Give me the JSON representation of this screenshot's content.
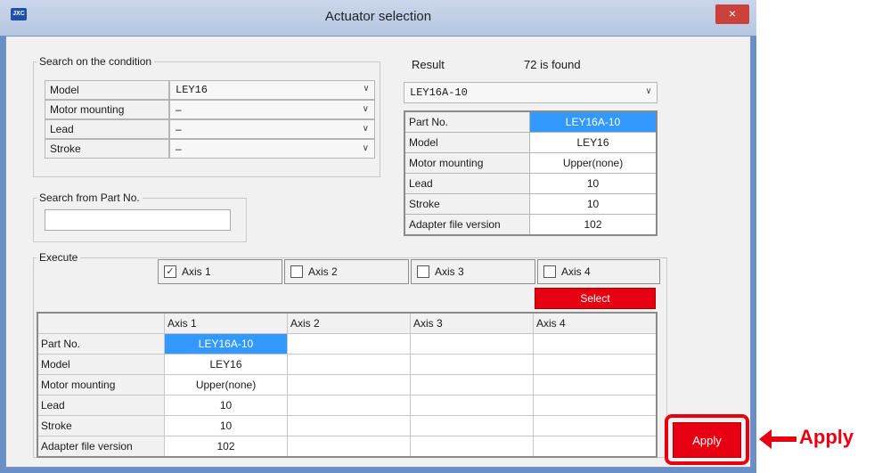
{
  "window": {
    "title": "Actuator selection",
    "app_icon_text": "JXC",
    "close_glyph": "×"
  },
  "search": {
    "group_label": "Search on the condition",
    "fields": [
      {
        "label": "Model",
        "value": "LEY16"
      },
      {
        "label": "Motor mounting",
        "value": "–"
      },
      {
        "label": "Lead",
        "value": "–"
      },
      {
        "label": "Stroke",
        "value": "–"
      }
    ]
  },
  "partno_search": {
    "group_label": "Search from Part No.",
    "value": ""
  },
  "result": {
    "label": "Result",
    "count_text": "72 is found",
    "selected": "LEY16A-10",
    "rows": [
      {
        "label": "Part No.",
        "value": "LEY16A-10"
      },
      {
        "label": "Model",
        "value": "LEY16"
      },
      {
        "label": "Motor mounting",
        "value": "Upper(none)"
      },
      {
        "label": "Lead",
        "value": "10"
      },
      {
        "label": "Stroke",
        "value": "10"
      },
      {
        "label": "Adapter file version",
        "value": "102"
      }
    ]
  },
  "execute": {
    "group_label": "Execute",
    "axes": [
      {
        "label": "Axis 1",
        "checked": true
      },
      {
        "label": "Axis 2",
        "checked": false
      },
      {
        "label": "Axis 3",
        "checked": false
      },
      {
        "label": "Axis 4",
        "checked": false
      }
    ],
    "select_label": "Select",
    "check_glyph": "✓"
  },
  "grid": {
    "headers": [
      "",
      "Axis 1",
      "Axis 2",
      "Axis 3",
      "Axis 4"
    ],
    "rows": [
      {
        "label": "Part No.",
        "cells": [
          "LEY16A-10",
          "",
          "",
          ""
        ]
      },
      {
        "label": "Model",
        "cells": [
          "LEY16",
          "",
          "",
          ""
        ]
      },
      {
        "label": "Motor mounting",
        "cells": [
          "Upper(none)",
          "",
          "",
          ""
        ]
      },
      {
        "label": "Lead",
        "cells": [
          "10",
          "",
          "",
          ""
        ]
      },
      {
        "label": "Stroke",
        "cells": [
          "10",
          "",
          "",
          ""
        ]
      },
      {
        "label": "Adapter file version",
        "cells": [
          "102",
          "",
          "",
          ""
        ]
      }
    ]
  },
  "apply": {
    "button_label": "Apply",
    "annotation": "Apply"
  },
  "colors": {
    "accent_red": "#e60012",
    "selection_blue": "#3399ff"
  },
  "icons": {
    "dropdown": "chevron-down-icon",
    "close": "close-icon",
    "arrow": "left-arrow-icon"
  }
}
